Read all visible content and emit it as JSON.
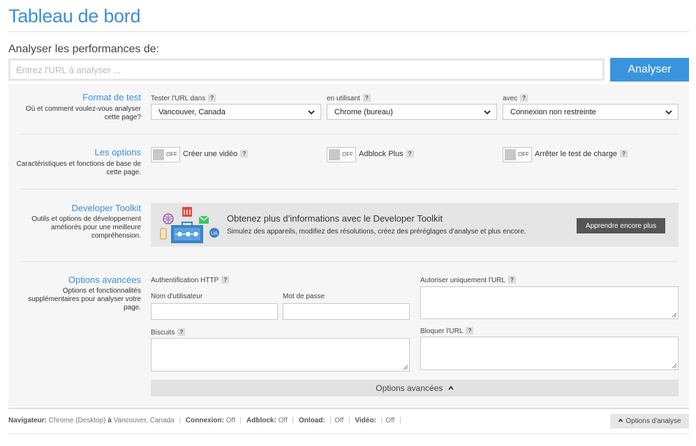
{
  "header": {
    "title": "Tableau de bord"
  },
  "analyze": {
    "label": "Analyser les performances de:",
    "placeholder": "Entrez l'URL à analyser ...",
    "button": "Analyser"
  },
  "test_format": {
    "title": "Format de test",
    "desc": "Où et comment voulez-vous analyser cette page?",
    "location_label": "Tester l'URL dans",
    "location_value": "Vancouver, Canada",
    "browser_label": "en utilisant",
    "browser_value": "Chrome (bureau)",
    "connection_label": "avec",
    "connection_value": "Connexion non restreinte",
    "help": "?"
  },
  "options": {
    "title": "Les options",
    "desc": "Caractéristiques et fonctions de base de cette page.",
    "toggle_state": "OFF",
    "video_label": "Créer une vidéo",
    "adblock_label": "Adblock Plus",
    "stop_label": "Arrêter le test de charge"
  },
  "toolkit": {
    "title": "Developer Toolkit",
    "desc": "Outils et options de développement améliorés pour une meilleure compréhension.",
    "heading": "Obtenez plus d’informations avec le Developer Toolkit",
    "sub": "Simulez des appareils, modifiez des résolutions, créez des préréglages d’analyse et plus encore.",
    "button": "Apprendre encore plus",
    "art_badge": "UA"
  },
  "advanced": {
    "title": "Options avancées",
    "desc": "Options et fonctionnalités supplémentaires pour analyser votre page.",
    "http_auth_label": "Authentification HTTP",
    "username_label": "Nom d'utilisateur",
    "password_label": "Mot de passe",
    "cookies_label": "Biscuits",
    "allow_url_label": "Autoriser uniquement l'URL",
    "block_url_label": "Bloquer l'URL",
    "toggle_label": "Options avancées"
  },
  "status": {
    "browser_key": "Navigateur:",
    "browser_val": "Chrome (Desktop)",
    "at": "à",
    "location_val": "Vancouver, Canada",
    "conn_key": "Connexion:",
    "conn_val": "Off",
    "adblock_key": "Adblock:",
    "adblock_val": "Off",
    "onload_key": "Onload:",
    "onload_val": "Off",
    "video_key": "Vidéo:",
    "video_val": "Off",
    "sep": "|",
    "options_button": "Options d'analyse"
  }
}
